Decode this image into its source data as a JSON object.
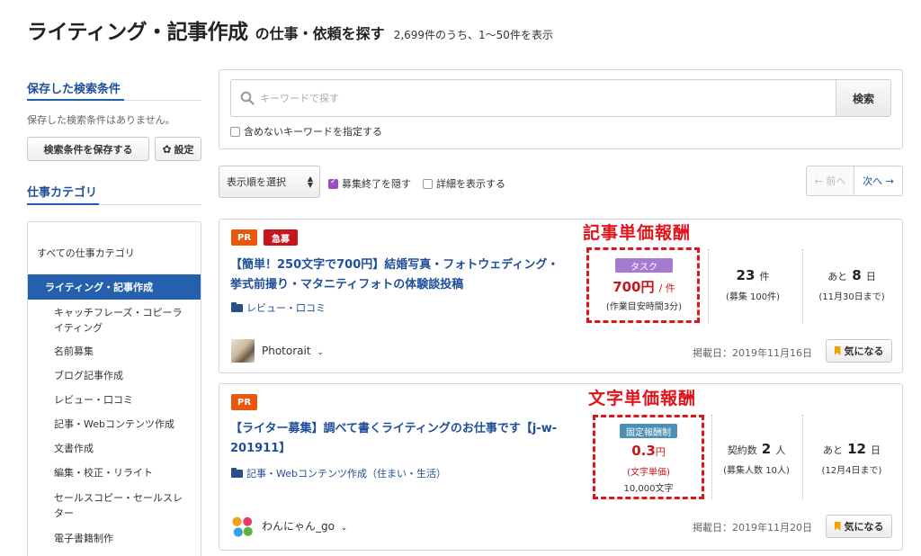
{
  "header": {
    "title_main": "ライティング・記事作成",
    "title_sub": "の仕事・依頼を探す",
    "result_count": "2,699件のうち、1〜50件を表示"
  },
  "sidebar": {
    "saved_heading": "保存した検索条件",
    "saved_empty": "保存した検索条件はありません。",
    "save_button": "検索条件を保存する",
    "settings_button": "設定",
    "category_heading": "仕事カテゴリ",
    "all_categories": "すべての仕事カテゴリ",
    "active_category": "ライティング・記事作成",
    "categories": [
      "キャッチフレーズ・コピーライティング",
      "名前募集",
      "ブログ記事作成",
      "レビュー・口コミ",
      "記事・Webコンテンツ作成",
      "文書作成",
      "編集・校正・リライト",
      "セールスコピー・セールスレター",
      "電子書籍制作"
    ]
  },
  "search": {
    "placeholder": "キーワードで探す",
    "button": "検索",
    "exclude_label": "含めないキーワードを指定する"
  },
  "toolbar": {
    "sort_label": "表示順を選択",
    "hide_closed_label": "募集終了を隠す",
    "show_details_label": "詳細を表示する",
    "prev_label": "← 前へ",
    "next_label": "次へ →"
  },
  "jobs": [
    {
      "badges": [
        "PR",
        "急募"
      ],
      "title": "【簡単！250文字で700円】結婚写真・フォトウェディング・挙式前撮り・マタニティフォトの体験談投稿",
      "category": "レビュー・口コミ",
      "annotation": "記事単価報酬",
      "pay_type": "タスク",
      "price": "700円",
      "price_unit": "/ 件",
      "price_note": "(作業目安時間3分)",
      "count_value": "23",
      "count_unit": "件",
      "count_note": "(募集 100件)",
      "days_prefix": "あと",
      "days_value": "8",
      "days_unit": "日",
      "deadline": "(11月30日まで)",
      "user": "Photorait",
      "posted": "掲載日：2019年11月16日",
      "fav": "気になる"
    },
    {
      "badges": [
        "PR"
      ],
      "title": "【ライター募集】調べて書くライティングのお仕事です【j-w-201911】",
      "category": "記事・Webコンテンツ作成（住まい・生活）",
      "annotation": "文字単価報酬",
      "pay_type": "固定報酬制",
      "price_value": "0.3",
      "price_yen": "円",
      "price_note": "(文字単価)",
      "price_extra": "10,000文字",
      "count_prefix": "契約数",
      "count_value": "2",
      "count_unit": "人",
      "count_note": "(募集人数 10人)",
      "days_prefix": "あと",
      "days_value": "12",
      "days_unit": "日",
      "deadline": "(12月4日まで)",
      "user": "わんにゃん_go",
      "posted": "掲載日：2019年11月20日",
      "fav": "気になる"
    }
  ],
  "colors": {
    "link_blue": "#1f4f99",
    "active_blue": "#2560ae",
    "pr_orange": "#e8570c",
    "urgent_red": "#c8161d",
    "annotation_red": "#e0141b",
    "task_purple": "#a57bd1",
    "fixed_teal": "#4a8fb4"
  }
}
